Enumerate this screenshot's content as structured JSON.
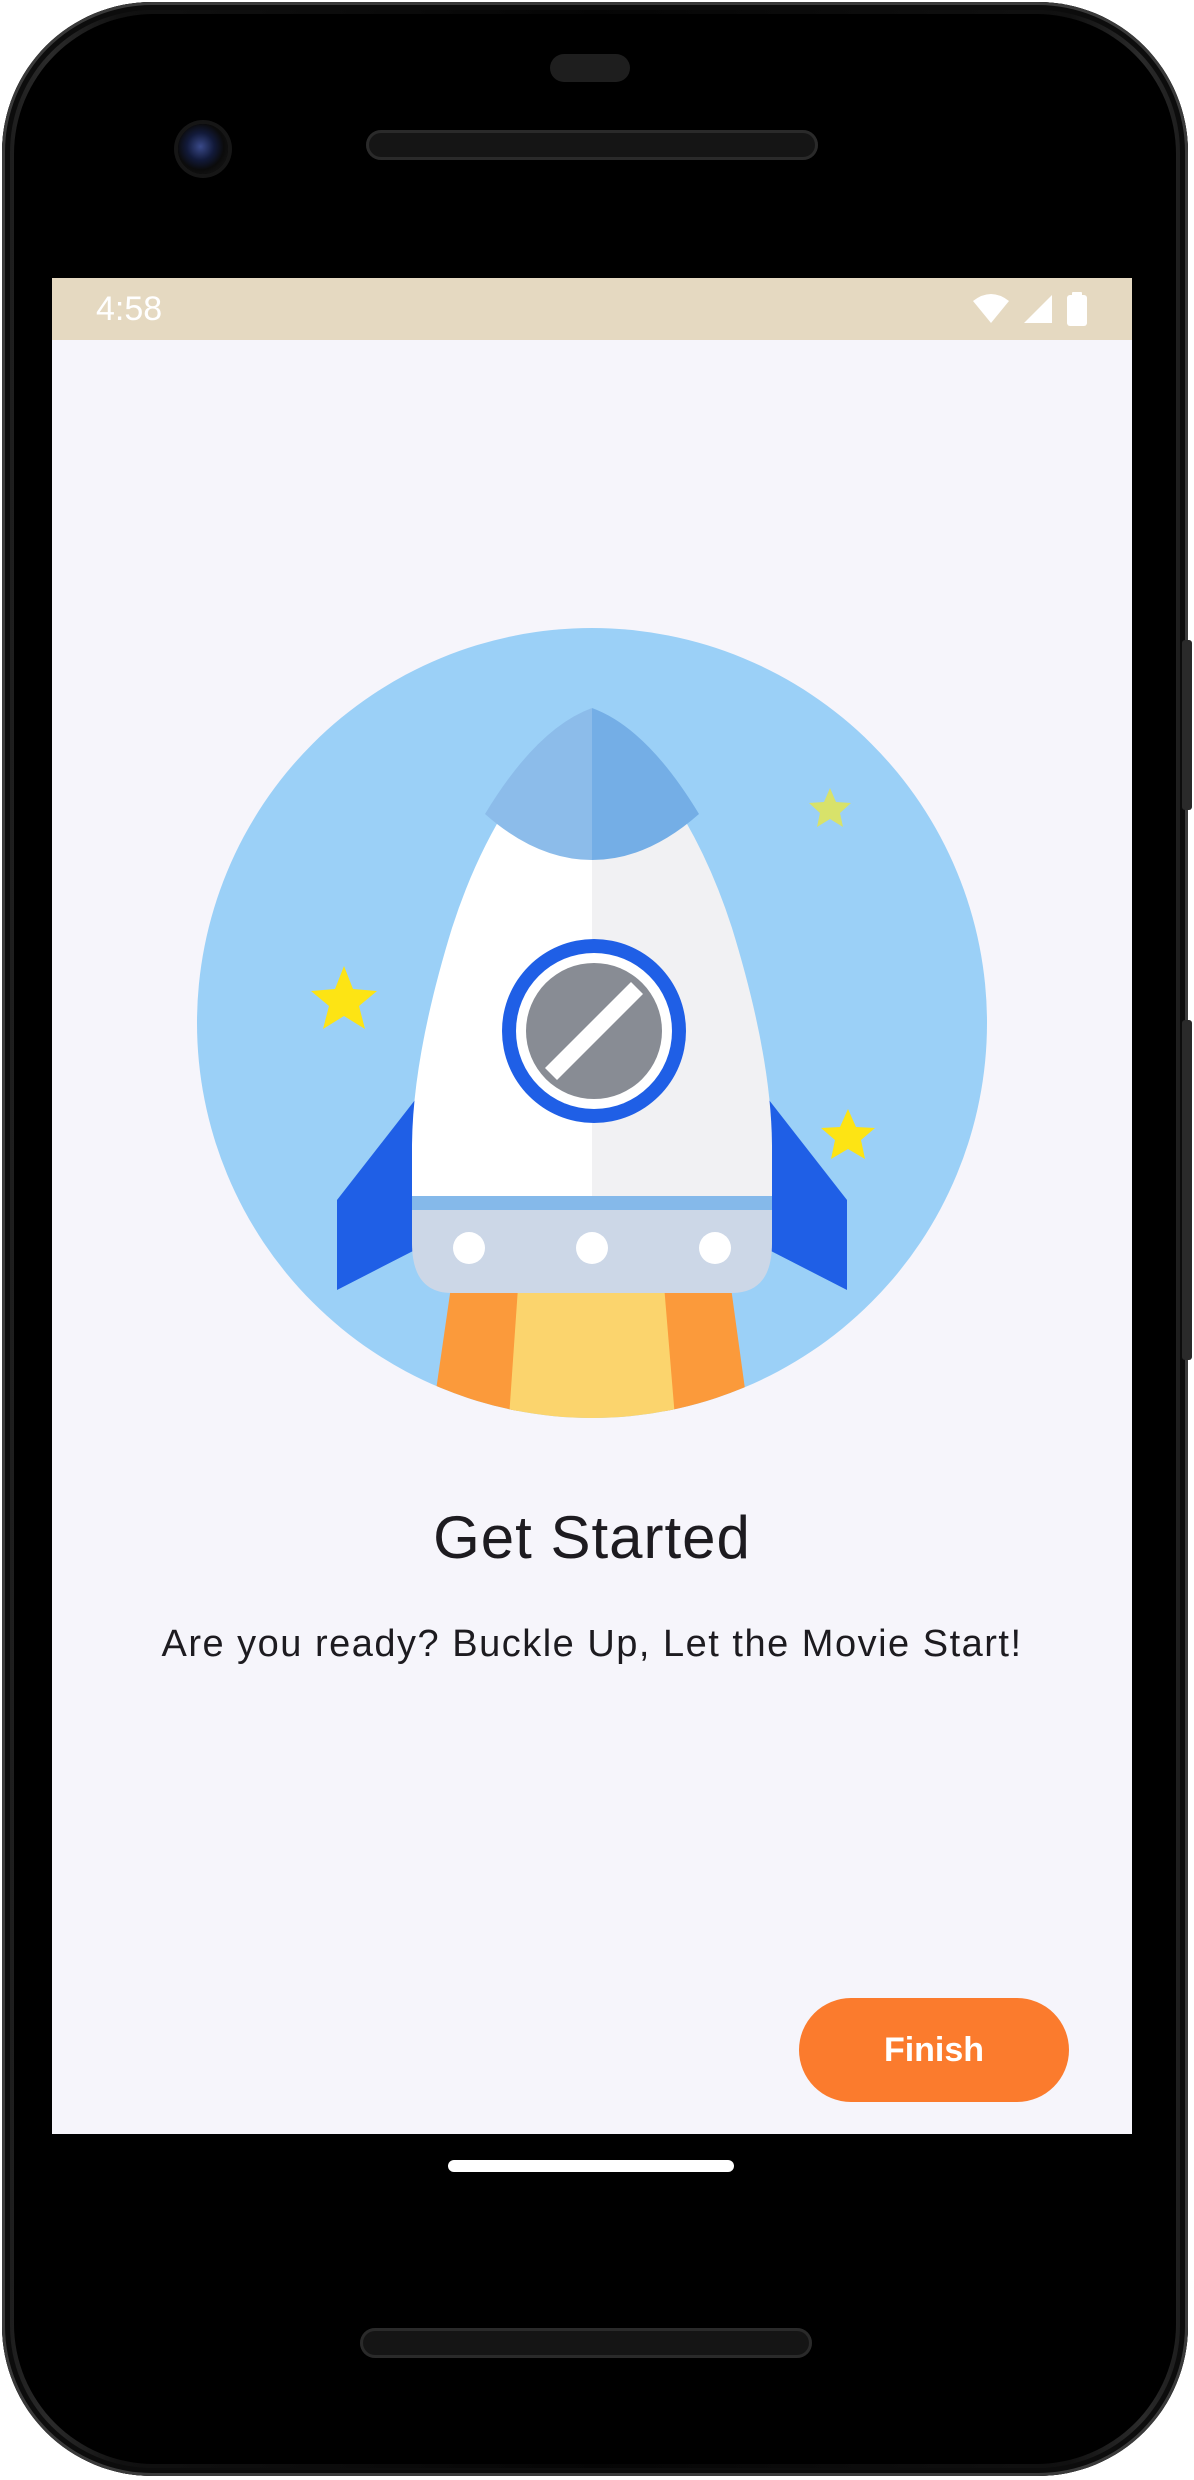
{
  "status_bar": {
    "time": "4:58",
    "icons": [
      "wifi-icon",
      "signal-icon",
      "battery-icon"
    ],
    "background_color": "#e5d9c1"
  },
  "onboarding": {
    "illustration": "rocket-illustration",
    "title": "Get Started",
    "subtitle": "Are you ready? Buckle Up, Let the Movie Start!"
  },
  "actions": {
    "finish_label": "Finish",
    "accent_color": "#fb7b2d"
  }
}
